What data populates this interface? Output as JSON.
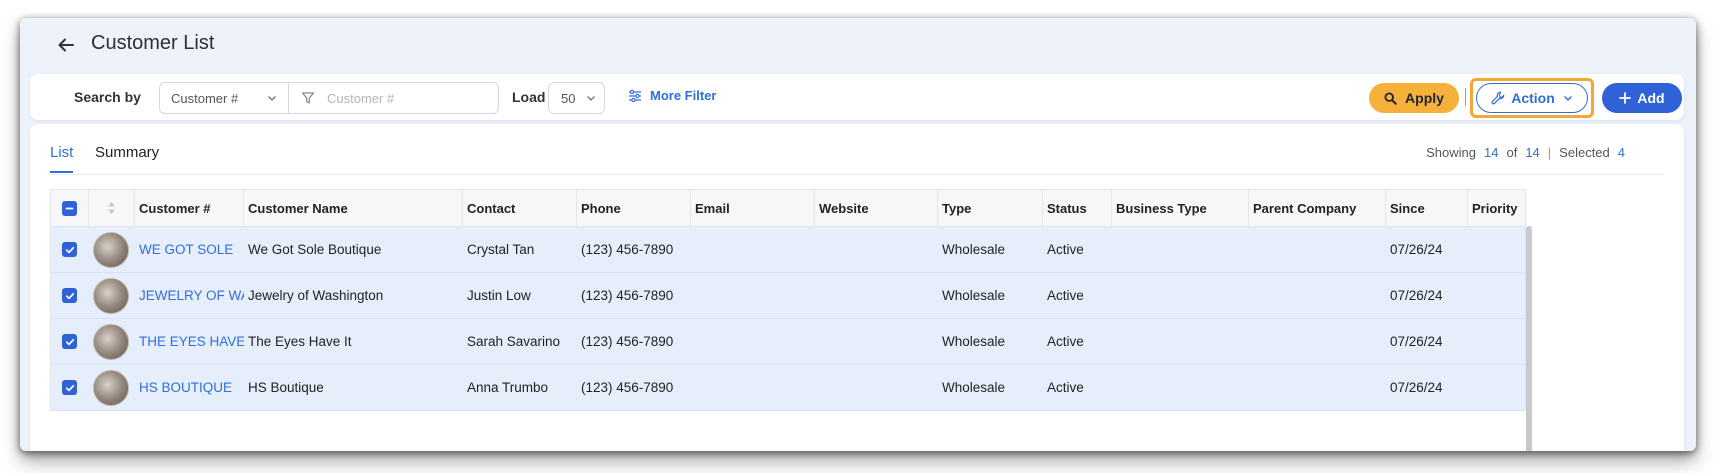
{
  "header": {
    "title": "Customer List"
  },
  "filter_bar": {
    "search_label": "Search by",
    "search_field_value": "Customer #",
    "search_placeholder": "Customer #",
    "load_label": "Load",
    "load_value": "50",
    "more_filter_label": "More Filter",
    "apply_label": "Apply",
    "action_label": "Action",
    "add_label": "Add"
  },
  "tabs": [
    {
      "label": "List",
      "active": true
    },
    {
      "label": "Summary",
      "active": false
    }
  ],
  "summary": {
    "showing_label": "Showing",
    "showing_count": "14",
    "of_label": "of",
    "total_count": "14",
    "selected_label": "Selected",
    "selected_count": "4"
  },
  "table": {
    "columns": [
      "Customer #",
      "Customer Name",
      "Contact",
      "Phone",
      "Email",
      "Website",
      "Type",
      "Status",
      "Business Type",
      "Parent Company",
      "Since",
      "Priority"
    ],
    "rows": [
      {
        "customer_no": "WE GOT SOLE",
        "name": "We Got Sole Boutique",
        "contact": "Crystal Tan",
        "phone": "(123) 456-7890",
        "email": "",
        "website": "",
        "type": "Wholesale",
        "status": "Active",
        "business_type": "",
        "parent_company": "",
        "since": "07/26/24",
        "priority": "",
        "selected": true
      },
      {
        "customer_no": "JEWELRY OF WA",
        "name": "Jewelry of Washington",
        "contact": "Justin Low",
        "phone": "(123) 456-7890",
        "email": "",
        "website": "",
        "type": "Wholesale",
        "status": "Active",
        "business_type": "",
        "parent_company": "",
        "since": "07/26/24",
        "priority": "",
        "selected": true
      },
      {
        "customer_no": "THE EYES HAVE IT",
        "name": "The Eyes Have It",
        "contact": "Sarah Savarino",
        "phone": "(123) 456-7890",
        "email": "",
        "website": "",
        "type": "Wholesale",
        "status": "Active",
        "business_type": "",
        "parent_company": "",
        "since": "07/26/24",
        "priority": "",
        "selected": true
      },
      {
        "customer_no": "HS BOUTIQUE",
        "name": "HS Boutique",
        "contact": "Anna Trumbo",
        "phone": "(123) 456-7890",
        "email": "",
        "website": "",
        "type": "Wholesale",
        "status": "Active",
        "business_type": "",
        "parent_company": "",
        "since": "07/26/24",
        "priority": "",
        "selected": true
      }
    ]
  },
  "colors": {
    "accent": "#2f6fd6",
    "apply": "#f6b13a",
    "highlight": "#f3a739",
    "row_selected": "#e6eefc"
  }
}
